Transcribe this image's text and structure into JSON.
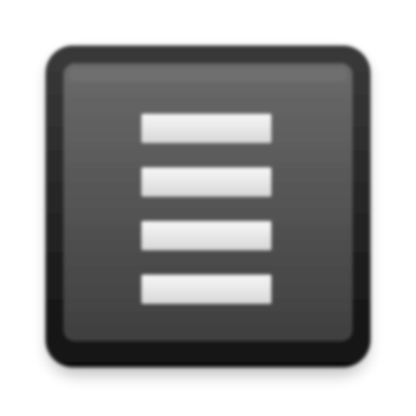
{
  "app_icon": {
    "icon": "menu-icon",
    "line_count": 4,
    "colors": {
      "frame": "#1c1c1c",
      "panel_top": "#6a6a6a",
      "panel_bottom": "#3f3f3f",
      "bar_top": "#f7f7f7",
      "bar_bottom": "#d8d8d8"
    }
  }
}
